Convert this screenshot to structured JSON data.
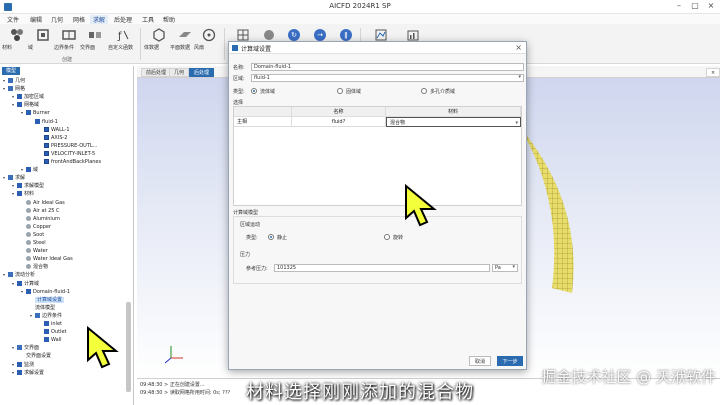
{
  "window": {
    "title": "AICFD 2024R1 SP"
  },
  "menu": [
    "文件",
    "编辑",
    "几何",
    "网格",
    "求解",
    "后处理",
    "工具",
    "帮助"
  ],
  "menu_active_index": 4,
  "ribbon": {
    "buttons": [
      "材料",
      "域",
      "边界条件",
      "交界面",
      "自定义函数",
      "体数据",
      "平面数据",
      "风扇"
    ],
    "group_label": "创建"
  },
  "sidebar": {
    "tab": "模型",
    "items": [
      {
        "label": "几何",
        "indent": 0,
        "icon": "folder"
      },
      {
        "label": "网格",
        "indent": 0,
        "icon": "folder"
      },
      {
        "label": "加密区域",
        "indent": 1,
        "icon": "blue"
      },
      {
        "label": "网格域",
        "indent": 1,
        "icon": "blue"
      },
      {
        "label": "Burner",
        "indent": 2,
        "icon": "blue"
      },
      {
        "label": "fluid-1",
        "indent": 3,
        "icon": "blue"
      },
      {
        "label": "WALL-1",
        "indent": 4,
        "icon": "check"
      },
      {
        "label": "AXIS-2",
        "indent": 4,
        "icon": "check"
      },
      {
        "label": "PRESSURE-OUTL...",
        "indent": 4,
        "icon": "check"
      },
      {
        "label": "VELOCITY-INLET-5",
        "indent": 4,
        "icon": "check"
      },
      {
        "label": "frontAndBackPlanes",
        "indent": 4,
        "icon": "check"
      },
      {
        "label": "域",
        "indent": 2,
        "icon": "blue"
      },
      {
        "label": "求解",
        "indent": 0,
        "icon": "folder"
      },
      {
        "label": "求解模型",
        "indent": 1,
        "icon": "blue"
      },
      {
        "label": "材料",
        "indent": 1,
        "icon": "blue"
      },
      {
        "label": "Air Ideal Gas",
        "indent": 2,
        "icon": "gray"
      },
      {
        "label": "Air at 25 C",
        "indent": 2,
        "icon": "gray"
      },
      {
        "label": "Aluminium",
        "indent": 2,
        "icon": "gray"
      },
      {
        "label": "Copper",
        "indent": 2,
        "icon": "gray"
      },
      {
        "label": "Soot",
        "indent": 2,
        "icon": "gray"
      },
      {
        "label": "Steel",
        "indent": 2,
        "icon": "gray"
      },
      {
        "label": "Water",
        "indent": 2,
        "icon": "gray"
      },
      {
        "label": "Water Ideal Gas",
        "indent": 2,
        "icon": "gray"
      },
      {
        "label": "混合物",
        "indent": 2,
        "icon": "gray"
      },
      {
        "label": "流动分析",
        "indent": 0,
        "icon": "folder"
      },
      {
        "label": "计算域",
        "indent": 1,
        "icon": "blue"
      },
      {
        "label": "Domain-fluid-1",
        "indent": 2,
        "icon": "blue"
      },
      {
        "label": "计算域设置",
        "indent": 3,
        "icon": "none",
        "selected": true
      },
      {
        "label": "流体模型",
        "indent": 3,
        "icon": "none"
      },
      {
        "label": "边界条件",
        "indent": 3,
        "icon": "folder"
      },
      {
        "label": "inlet",
        "indent": 4,
        "icon": "blue"
      },
      {
        "label": "Outlet",
        "indent": 4,
        "icon": "blue"
      },
      {
        "label": "Wall",
        "indent": 4,
        "icon": "blue"
      },
      {
        "label": "交界面",
        "indent": 1,
        "icon": "folder"
      },
      {
        "label": "交界面设置",
        "indent": 2,
        "icon": "none"
      },
      {
        "label": "监测",
        "indent": 1,
        "icon": "blue"
      },
      {
        "label": "求解设置",
        "indent": 1,
        "icon": "blue"
      }
    ]
  },
  "view_tabs": [
    "前后处理",
    "几何",
    "后处理"
  ],
  "view_tab_active": 2,
  "dialog": {
    "title": "计算域设置",
    "name_label": "名称:",
    "name_value": "Domain-fluid-1",
    "region_label": "区域:",
    "region_value": "fluid-1",
    "type_label": "类型:",
    "types": [
      "流体域",
      "固体域",
      "多孔介质域"
    ],
    "type_selected": 0,
    "select_label": "选择",
    "table_headers": [
      "",
      "名称",
      "材料"
    ],
    "table_row": {
      "col0": "主相",
      "name": "fluid?",
      "material": "混合物"
    },
    "model_section": "计算域模型",
    "motion_label": "区域运动",
    "motion_type_label": "类型:",
    "motion_types": [
      "静止",
      "旋转"
    ],
    "motion_selected": 0,
    "pressure_section": "压力",
    "ref_pressure_label": "参考压力:",
    "ref_pressure_value": "101325",
    "ref_pressure_unit": "Pa",
    "cancel_label": "取消",
    "next_label": "下一步"
  },
  "console": {
    "lines": [
      "09:48:30 > 正在创建设置...",
      "09:48:30 > 读取网格所用时间: 0s; ???"
    ]
  },
  "subtitle": "材料选择刚刚添加的混合物",
  "watermark": "掘金技术社区 @ 天洑软件"
}
